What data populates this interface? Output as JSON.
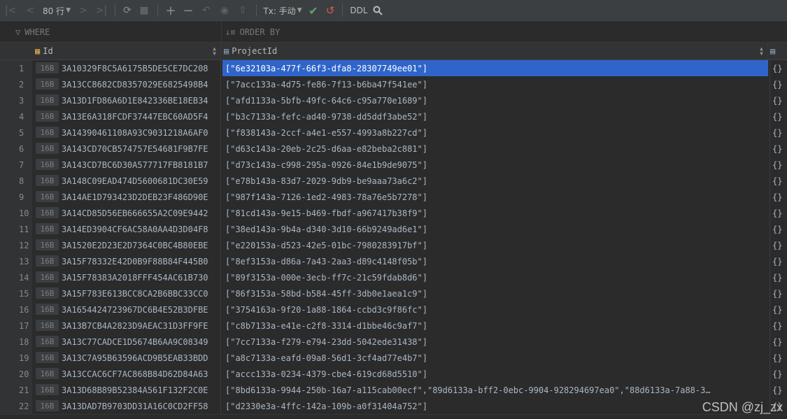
{
  "toolbar": {
    "rows_label": "80 行",
    "tx_label": "Tx: 手动",
    "ddl_label": "DDL",
    "icons": [
      "first-page-icon",
      "prev-page-icon",
      "next-page-icon",
      "last-page-icon",
      "refresh-icon",
      "stop-icon",
      "add-row-icon",
      "delete-row-icon",
      "revert-icon",
      "preview-icon",
      "submit-icon",
      "commit-icon",
      "rollback-icon",
      "search-icon"
    ]
  },
  "filters": {
    "where_label": "WHERE",
    "orderby_label": "ORDER BY"
  },
  "columns": [
    {
      "label": "Id"
    },
    {
      "label": "ProjectId"
    }
  ],
  "rows": [
    {
      "num": "1",
      "size": "16B",
      "id": "3A10329F8C5A6175B5DE5CE7DC208",
      "pid": "[\"6e32103a-477f-66f3-dfa8-28307749ee01\"]",
      "obj": "{}"
    },
    {
      "num": "2",
      "size": "16B",
      "id": "3A13CC8682CD8357029E6825498B4",
      "pid": "[\"7acc133a-4d75-fe86-7f13-b6ba47f541ee\"]",
      "obj": "{}"
    },
    {
      "num": "3",
      "size": "16B",
      "id": "3A13D1FD86A6D1E842336BE18EB34",
      "pid": "[\"afd1133a-5bfb-49fc-64c6-c95a770e1689\"]",
      "obj": "{}"
    },
    {
      "num": "4",
      "size": "16B",
      "id": "3A13E6A318FCDF37447EBC60AD5F4",
      "pid": "[\"b3c7133a-fefc-ad40-9738-dd5ddf3abe52\"]",
      "obj": "{}"
    },
    {
      "num": "5",
      "size": "16B",
      "id": "3A14390461108A93C9031218A6AF0",
      "pid": "[\"f838143a-2ccf-a4e1-e557-4993a8b227cd\"]",
      "obj": "{}"
    },
    {
      "num": "6",
      "size": "16B",
      "id": "3A143CD70CB574757E54681F9B7FE",
      "pid": "[\"d63c143a-20eb-2c25-d6aa-e82beba2c881\"]",
      "obj": "{}"
    },
    {
      "num": "7",
      "size": "16B",
      "id": "3A143CD7BC6D30A577717FB8181B7",
      "pid": "[\"d73c143a-c998-295a-0926-84e1b9de9075\"]",
      "obj": "{}"
    },
    {
      "num": "8",
      "size": "16B",
      "id": "3A148C09EAD474D5600681DC30E59",
      "pid": "[\"e78b143a-83d7-2029-9db9-be9aaa73a6c2\"]",
      "obj": "{}"
    },
    {
      "num": "9",
      "size": "16B",
      "id": "3A14AE1D793423D2DEB23F486D90E",
      "pid": "[\"987f143a-7126-1ed2-4983-78a76e5b7278\"]",
      "obj": "{}"
    },
    {
      "num": "10",
      "size": "16B",
      "id": "3A14CD85D56EB666655A2C09E9442",
      "pid": "[\"81cd143a-9e15-b469-fbdf-a967417b38f9\"]",
      "obj": "{}"
    },
    {
      "num": "11",
      "size": "16B",
      "id": "3A14ED3904CF6AC58A0AA4D3D04F8",
      "pid": "[\"38ed143a-9b4a-d340-3d10-66b9249ad6e1\"]",
      "obj": "{}"
    },
    {
      "num": "12",
      "size": "16B",
      "id": "3A1520E2D23E2D7364C0BC4B80EBE",
      "pid": "[\"e220153a-d523-42e5-01bc-7980283917bf\"]",
      "obj": "{}"
    },
    {
      "num": "13",
      "size": "16B",
      "id": "3A15F78332E42D0B9F88B84F445B0",
      "pid": "[\"8ef3153a-d86a-7a43-2aa3-d89c4148f05b\"]",
      "obj": "{}"
    },
    {
      "num": "14",
      "size": "16B",
      "id": "3A15F78383A2018FFF454AC61B730",
      "pid": "[\"89f3153a-000e-3ecb-ff7c-21c59fdab8d6\"]",
      "obj": "{}"
    },
    {
      "num": "15",
      "size": "16B",
      "id": "3A15F783E613BCC8CA2B6BBC33CC0",
      "pid": "[\"86f3153a-58bd-b584-45ff-3db0e1aea1c9\"]",
      "obj": "{}"
    },
    {
      "num": "16",
      "size": "16B",
      "id": "3A1654424723967DC6B4E52B3DFBE",
      "pid": "[\"3754163a-9f20-1a88-1864-ccbd3c9f86fc\"]",
      "obj": "{}"
    },
    {
      "num": "17",
      "size": "16B",
      "id": "3A13B7CB4A2823D9AEAC31D3FF9FE",
      "pid": "[\"c8b7133a-e41e-c2f8-3314-d1bbe46c9af7\"]",
      "obj": "{}"
    },
    {
      "num": "18",
      "size": "16B",
      "id": "3A13C77CADCE1D5674B6AA9C08349",
      "pid": "[\"7cc7133a-f279-e794-23dd-5042ede31438\"]",
      "obj": "{}"
    },
    {
      "num": "19",
      "size": "16B",
      "id": "3A13C7A95B63596ACD9B5EAB33BDD",
      "pid": "[\"a8c7133a-eafd-09a8-56d1-3cf4ad77e4b7\"]",
      "obj": "{}"
    },
    {
      "num": "20",
      "size": "16B",
      "id": "3A13CCAC6CF7AC868B84D62D84A63",
      "pid": "[\"accc133a-0234-4379-cbe4-619cd68d5510\"]",
      "obj": "{}"
    },
    {
      "num": "21",
      "size": "16B",
      "id": "3A13D68B89B52384A561F132F2C0E",
      "pid": "[\"8bd6133a-9944-250b-16a7-a115cab00ecf\",\"89d6133a-bff2-0ebc-9904-928294697ea0\",\"88d6133a-7a88-3…",
      "obj": "{}"
    },
    {
      "num": "22",
      "size": "16B",
      "id": "3A13DAD7B9703DD31A16C0CD2FF58",
      "pid": "[\"d2330e3a-4ffc-142a-109b-a0f31404a752\"]",
      "obj": "{}"
    }
  ],
  "watermark": "CSDN @zj_zx"
}
